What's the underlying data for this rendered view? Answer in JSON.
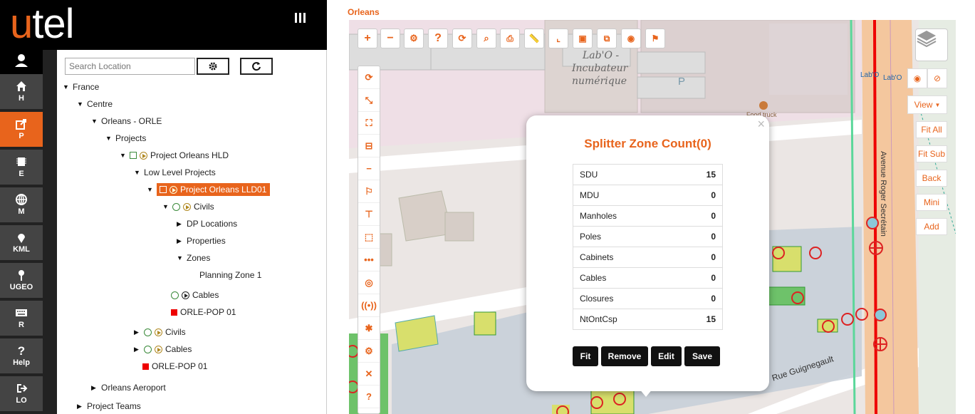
{
  "app": {
    "logo_u": "u",
    "logo_rest": "tel"
  },
  "rail": [
    {
      "label": "H",
      "icon": "home-icon"
    },
    {
      "label": "P",
      "icon": "export-icon",
      "active": true
    },
    {
      "label": "E",
      "icon": "chip-icon"
    },
    {
      "label": "M",
      "icon": "globe-icon"
    },
    {
      "label": "KML",
      "icon": "pin-icon"
    },
    {
      "label": "UGEO",
      "icon": "map-marker-icon"
    },
    {
      "label": "R",
      "icon": "keyboard-icon"
    },
    {
      "label": "Help",
      "icon": "question-icon"
    },
    {
      "label": "LO",
      "icon": "logout-icon"
    }
  ],
  "search": {
    "placeholder": "Search Location"
  },
  "tree": {
    "france": "France",
    "centre": "Centre",
    "orleans": "Orleans - ORLE",
    "projects": "Projects",
    "project_hld": "Project Orleans HLD",
    "low_level": "Low Level Projects",
    "project_lld": "Project Orleans LLD01",
    "civils_inner": "Civils",
    "dp_locations": "DP Locations",
    "properties": "Properties",
    "zones": "Zones",
    "planning_zone": "Planning Zone 1",
    "cables_inner": "Cables",
    "pop_inner": "ORLE-POP 01",
    "civils_outer": "Civils",
    "cables_outer": "Cables",
    "pop_outer": "ORLE-POP 01",
    "aeroport": "Orleans Aeroport",
    "project_teams": "Project Teams"
  },
  "map": {
    "title": "Orleans",
    "labels": {
      "lab": "Lab'O -",
      "incubateur": "Incubateur",
      "numerique": "numérique",
      "foodtruck": "Food truck",
      "avenue": "Avenue Roger Secrétain",
      "rue": "Rue Guignegault",
      "labo_small1": "Lab'O",
      "labo_small2": "Lab'O",
      "parking": "P"
    },
    "side_buttons": {
      "view": "View",
      "fit_all": "Fit All",
      "fit_sub": "Fit Sub",
      "back": "Back",
      "mini": "Mini",
      "add": "Add"
    }
  },
  "modal": {
    "title": "Splitter Zone Count(0)",
    "rows": [
      {
        "name": "SDU",
        "value": "15"
      },
      {
        "name": "MDU",
        "value": "0"
      },
      {
        "name": "Manholes",
        "value": "0"
      },
      {
        "name": "Poles",
        "value": "0"
      },
      {
        "name": "Cabinets",
        "value": "0"
      },
      {
        "name": "Cables",
        "value": "0"
      },
      {
        "name": "Closures",
        "value": "0"
      },
      {
        "name": "NtOntCsp",
        "value": "15"
      }
    ],
    "buttons": {
      "fit": "Fit",
      "remove": "Remove",
      "edit": "Edit",
      "save": "Save"
    },
    "close": "×"
  },
  "colors": {
    "accent": "#e8641c",
    "rail": "#444",
    "active": "#e8641c"
  }
}
